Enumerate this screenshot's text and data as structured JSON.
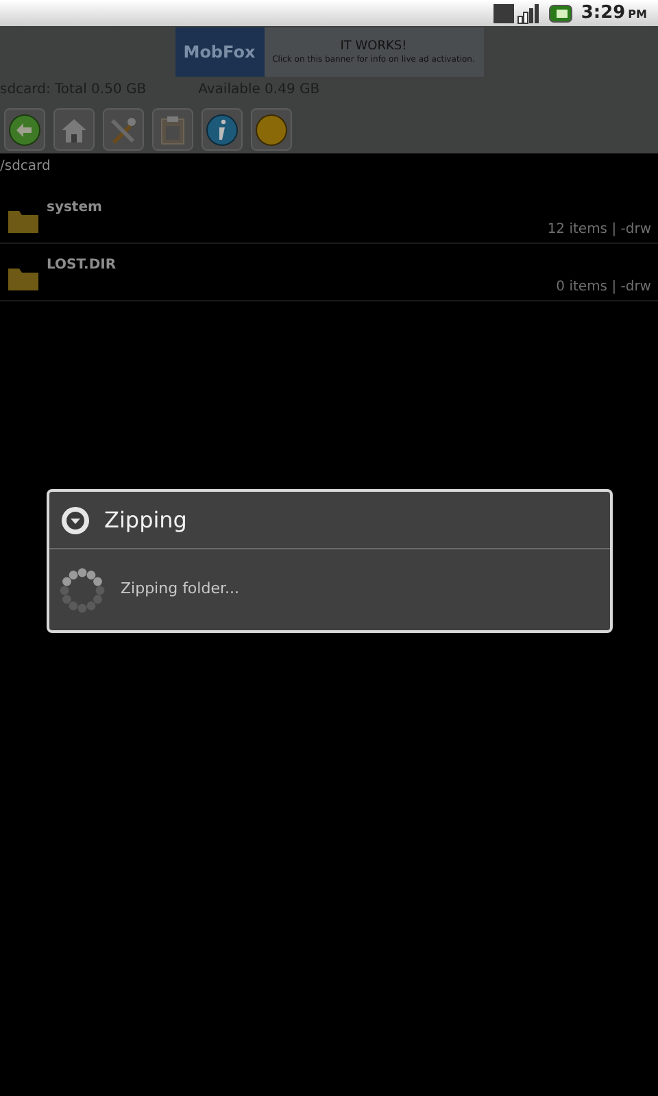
{
  "status_bar": {
    "time": "3:29",
    "period": "PM"
  },
  "ad": {
    "brand": "MobFox",
    "headline": "IT WORKS!",
    "text": "Click on this banner for info on live ad activation."
  },
  "storage": {
    "total": "sdcard: Total 0.50 GB",
    "available": "Available 0.49 GB"
  },
  "path": "/sdcard",
  "files": [
    {
      "name": "system",
      "info": "12 items | -drw"
    },
    {
      "name": "LOST.DIR",
      "info": "0 items | -drw"
    }
  ],
  "dialog": {
    "title": "Zipping",
    "message": "Zipping folder..."
  }
}
